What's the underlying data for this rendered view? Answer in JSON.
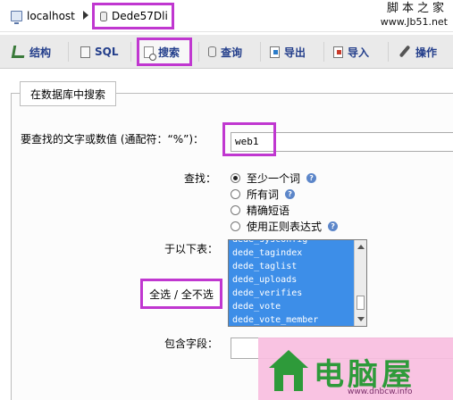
{
  "breadcrumb": {
    "server": "localhost",
    "database": "Dede57Dli"
  },
  "watermark": {
    "cn": "脚本之家",
    "url": "www.Jb51.net"
  },
  "tabs": [
    {
      "label": "结构",
      "icon": "structure-icon"
    },
    {
      "label": "SQL",
      "icon": "sql-icon"
    },
    {
      "label": "搜索",
      "icon": "search-icon",
      "active": true
    },
    {
      "label": "查询",
      "icon": "query-icon"
    },
    {
      "label": "导出",
      "icon": "export-icon"
    },
    {
      "label": "导入",
      "icon": "import-icon"
    },
    {
      "label": "操作",
      "icon": "operations-icon"
    }
  ],
  "form": {
    "legend": "在数据库中搜索",
    "search_label": "要查找的文字或数值 (通配符：“%”)：",
    "search_value": "web1",
    "find_label": "查找：",
    "options": [
      {
        "label": "至少一个词",
        "checked": true,
        "help": true
      },
      {
        "label": "所有词",
        "checked": false,
        "help": true
      },
      {
        "label": "精确短语",
        "checked": false,
        "help": false
      },
      {
        "label": "使用正则表达式",
        "checked": false,
        "help": true
      }
    ],
    "tables_label": "于以下表：",
    "tables": [
      "dede_sysconfig",
      "dede_tagindex",
      "dede_taglist",
      "dede_uploads",
      "dede_verifies",
      "dede_vote",
      "dede_vote_member"
    ],
    "select_all": "全选 / 全不选",
    "fields_label": "包含字段：",
    "fields_value": ""
  },
  "logo_watermark": {
    "text": "电脑屋",
    "url": "www.dnbcw.info"
  },
  "colors": {
    "highlight": "#c037d0",
    "tab_text": "#233e8b",
    "list_selected": "#3d8ee8"
  }
}
